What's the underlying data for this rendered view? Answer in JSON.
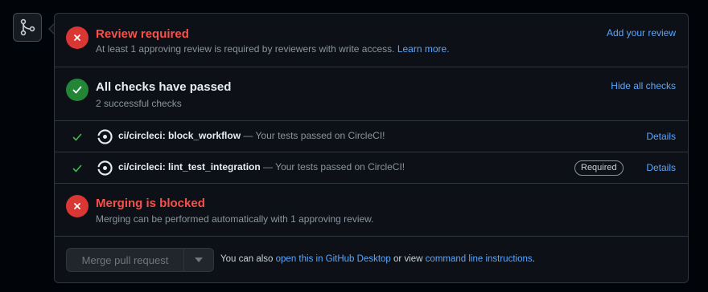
{
  "review": {
    "title": "Review required",
    "subtitle": "At least 1 approving review is required by reviewers with write access.",
    "learn_more": "Learn more.",
    "action": "Add your review"
  },
  "checks_summary": {
    "title": "All checks have passed",
    "subtitle": "2 successful checks",
    "action": "Hide all checks"
  },
  "checks": [
    {
      "name": "ci/circleci: block_workflow",
      "description": " — Your tests passed on CircleCI!",
      "required": false,
      "details": "Details"
    },
    {
      "name": "ci/circleci: lint_test_integration",
      "description": " — Your tests passed on CircleCI!",
      "required": true,
      "required_label": "Required",
      "details": "Details"
    }
  ],
  "merge_status": {
    "title": "Merging is blocked",
    "subtitle": "Merging can be performed automatically with 1 approving review."
  },
  "merge_box": {
    "button_label": "Merge pull request",
    "note_prefix": "You can also ",
    "desktop_link": "open this in GitHub Desktop",
    "note_middle": " or view ",
    "cli_link": "command line instructions",
    "note_suffix": "."
  },
  "colors": {
    "error": "#f85149",
    "success": "#238636",
    "link": "#58a6ff"
  },
  "icons": {
    "timeline": "git-merge-icon",
    "review_status": "x-circle-icon",
    "checks_status": "check-circle-icon",
    "merge_status": "x-circle-icon",
    "check_row": "check-icon",
    "ci_provider": "circleci-logo-icon",
    "merge_dropdown": "caret-down-icon"
  }
}
